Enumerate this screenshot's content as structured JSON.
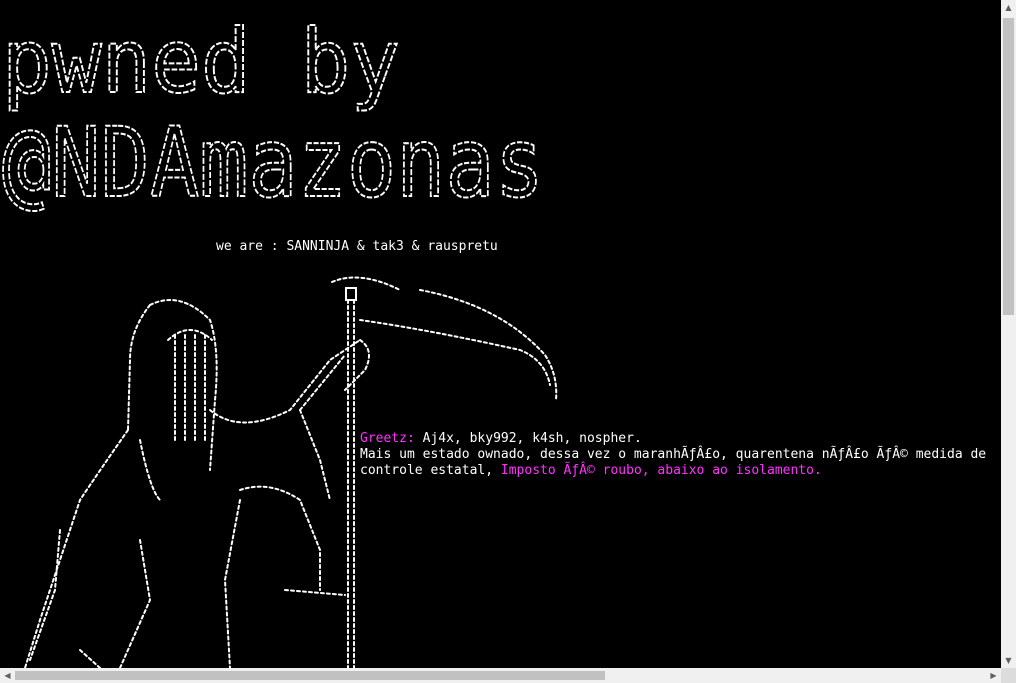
{
  "banner": {
    "line1": "pwned by",
    "line2": "@NDAmazonas"
  },
  "crew_line": "we are : SANNINJA & tak3 & rauspretu",
  "message": {
    "greetz_label": "Greetz:",
    "greetz_names": " Aj4x, bky992, k4sh, nospher.",
    "line2": "Mais um estado ownado, dessa vez o maranhÃƒÂ£o, quarentena nÃƒÂ£o ÃƒÂ© medida de",
    "line3_prefix": "controle estatal, ",
    "line3_highlight": "Imposto ÃƒÂ© roubo, abaixo ao isolamento."
  },
  "scrollbars": {
    "up_arrow": "▲",
    "down_arrow": "▼",
    "left_arrow": "◀",
    "right_arrow": "▶"
  }
}
